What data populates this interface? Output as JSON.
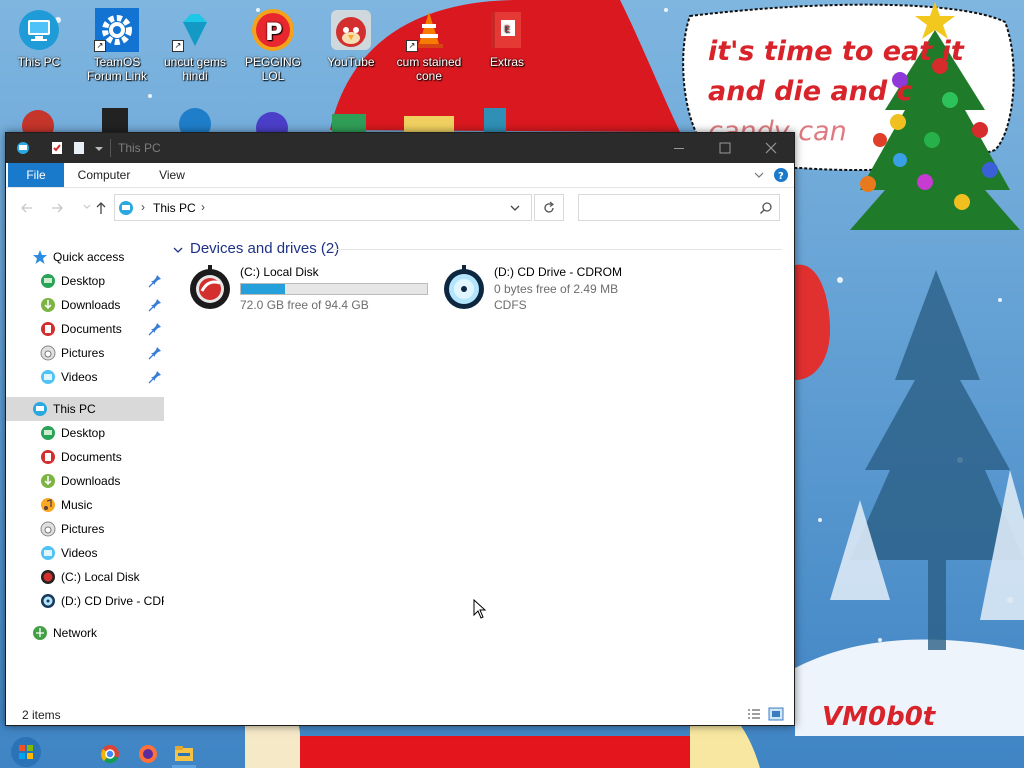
{
  "desktop": {
    "icons": [
      {
        "label": "This PC",
        "icon": "monitor-icon"
      },
      {
        "label": "TeamOS Forum Link",
        "icon": "gear-icon"
      },
      {
        "label": "uncut gems hindi",
        "icon": "diamond-icon"
      },
      {
        "label": "PEGGING LOL",
        "icon": "p-logo-icon"
      },
      {
        "label": "YouTube",
        "icon": "angry-bird-icon"
      },
      {
        "label": "cum stained cone",
        "icon": "traffic-cone-icon"
      },
      {
        "label": "Extras",
        "icon": "book-icon"
      }
    ],
    "wallpaper_text": {
      "line1": "it's time to eat it",
      "line2": "and die and c",
      "line3": "candy can"
    },
    "signature": "VM0b0t"
  },
  "window": {
    "title": "This PC",
    "ribbon_tabs": [
      "File",
      "Computer",
      "View"
    ],
    "address": {
      "location": "This PC",
      "separator": "›"
    },
    "search": {
      "placeholder": ""
    },
    "nav": {
      "quick_access": "Quick access",
      "quick_items": [
        {
          "label": "Desktop",
          "pinned": true
        },
        {
          "label": "Downloads",
          "pinned": true
        },
        {
          "label": "Documents",
          "pinned": true
        },
        {
          "label": "Pictures",
          "pinned": true
        },
        {
          "label": "Videos",
          "pinned": true
        }
      ],
      "this_pc": "This PC",
      "this_pc_items": [
        "Desktop",
        "Documents",
        "Downloads",
        "Music",
        "Pictures",
        "Videos",
        "(C:) Local Disk",
        "(D:) CD Drive - CDR"
      ],
      "network": "Network"
    },
    "content": {
      "group_header": "Devices and drives (2)",
      "drives": [
        {
          "name": "(C:) Local Disk",
          "free_text": "72.0 GB free of 94.4 GB",
          "used_fraction": 0.237
        },
        {
          "name": "(D:) CD Drive - CDROM",
          "free_text": "0 bytes free of 2.49 MB",
          "fs": "CDFS"
        }
      ]
    },
    "status": {
      "count": "2 items"
    }
  },
  "colors": {
    "accent": "#1979ca",
    "titlebar": "#2b2b2b",
    "group_header": "#1e3287",
    "drive_bar": "#26a0da",
    "wallpaper_text": "#d8232a"
  }
}
